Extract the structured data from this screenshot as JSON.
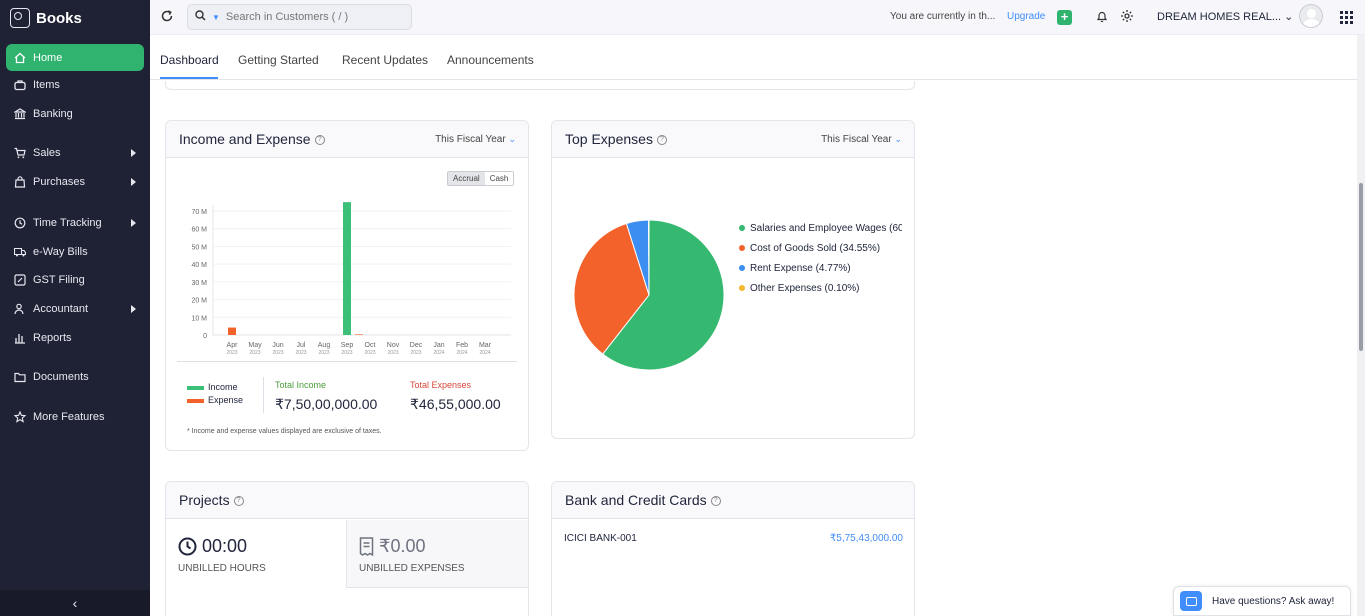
{
  "app": {
    "name": "Books"
  },
  "sidebar": {
    "items": [
      {
        "label": "Home",
        "icon": "home-icon",
        "active": true
      },
      {
        "label": "Items",
        "icon": "items-icon"
      },
      {
        "label": "Banking",
        "icon": "bank-icon"
      },
      {
        "label": "Sales",
        "icon": "cart-icon",
        "has_submenu": true
      },
      {
        "label": "Purchases",
        "icon": "bag-icon",
        "has_submenu": true
      },
      {
        "label": "Time Tracking",
        "icon": "clock-icon",
        "has_submenu": true
      },
      {
        "label": "e-Way Bills",
        "icon": "truck-icon"
      },
      {
        "label": "GST Filing",
        "icon": "gst-icon"
      },
      {
        "label": "Accountant",
        "icon": "accountant-icon",
        "has_submenu": true
      },
      {
        "label": "Reports",
        "icon": "reports-icon"
      },
      {
        "label": "Documents",
        "icon": "folder-icon"
      },
      {
        "label": "More Features",
        "icon": "star-icon"
      }
    ],
    "collapse_glyph": "‹"
  },
  "topbar": {
    "search_placeholder": "Search in Customers ( / )",
    "org_note": "You are currently in th...",
    "upgrade": "Upgrade",
    "org_name": "DREAM HOMES REAL...",
    "org_caret": "⌄"
  },
  "tabs": [
    "Dashboard",
    "Getting Started",
    "Recent Updates",
    "Announcements"
  ],
  "income_expense": {
    "title": "Income and Expense",
    "period": "This Fiscal Year",
    "toggle": [
      "Accrual",
      "Cash"
    ],
    "legend": [
      "Income",
      "Expense"
    ],
    "total_income_label": "Total Income",
    "total_income": "₹7,50,00,000.00",
    "total_expenses_label": "Total Expenses",
    "total_expenses": "₹46,55,000.00",
    "footnote": "* Income and expense values displayed are exclusive of taxes.",
    "colors": {
      "income": "#3cbf76",
      "expense": "#f3622b",
      "income_label": "#4a9c3b",
      "expense_label": "#d9483b"
    }
  },
  "top_expenses": {
    "title": "Top Expenses",
    "period": "This Fiscal Year"
  },
  "projects": {
    "title": "Projects",
    "unbilled_hours": "00:00",
    "unbilled_hours_label": "UNBILLED HOURS",
    "unbilled_expenses": "₹0.00",
    "unbilled_expenses_label": "UNBILLED EXPENSES"
  },
  "bank": {
    "title": "Bank and Credit Cards",
    "accounts": [
      {
        "name": "ICICI BANK-001",
        "amount": "₹5,75,43,000.00"
      }
    ]
  },
  "chat": {
    "label": "Have questions? Ask away!"
  },
  "chart_data": [
    {
      "type": "bar",
      "title": "Income and Expense",
      "categories": [
        "Apr",
        "May",
        "Jun",
        "Jul",
        "Aug",
        "Sep",
        "Oct",
        "Nov",
        "Dec",
        "Jan",
        "Feb",
        "Mar"
      ],
      "category_years": [
        "2023",
        "2023",
        "2023",
        "2023",
        "2023",
        "2023",
        "2023",
        "2023",
        "2023",
        "2024",
        "2024",
        "2024"
      ],
      "series": [
        {
          "name": "Income",
          "values": [
            0,
            0,
            0,
            0,
            0,
            75000000,
            0,
            0,
            0,
            0,
            0,
            0
          ],
          "color": "#3cbf76"
        },
        {
          "name": "Expense",
          "values": [
            4200000,
            0,
            0,
            0,
            0,
            355000,
            0,
            0,
            0,
            0,
            0,
            0
          ],
          "color": "#f3622b"
        }
      ],
      "y_ticks": [
        "0",
        "10 M",
        "20 M",
        "30 M",
        "40 M",
        "50 M",
        "60 M",
        "70 M"
      ],
      "ylim": [
        0,
        70000000
      ],
      "grid": true
    },
    {
      "type": "pie",
      "title": "Top Expenses",
      "legend_position": "right",
      "slices": [
        {
          "label": "Salaries and Employee Wages (60",
          "value": 60.58,
          "color": "#35b86f"
        },
        {
          "label": "Cost of Goods Sold (34.55%)",
          "value": 34.55,
          "color": "#f3622b"
        },
        {
          "label": "Rent Expense (4.77%)",
          "value": 4.77,
          "color": "#3c8ef0"
        },
        {
          "label": "Other Expenses (0.10%)",
          "value": 0.1,
          "color": "#f5b82e"
        }
      ]
    }
  ]
}
